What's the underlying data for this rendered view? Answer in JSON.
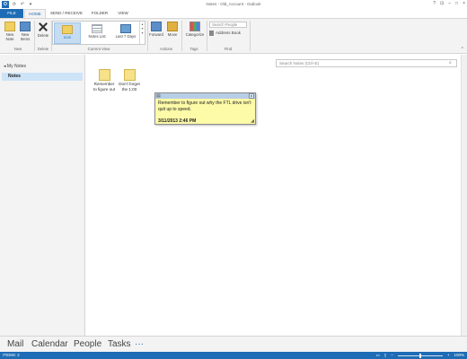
{
  "window": {
    "title": "Notes - Old_Account - Outlook",
    "app_icon": "O",
    "quick_access": [
      "save-icon",
      "undo-icon",
      "send-receive-icon"
    ],
    "controls": [
      "?",
      "□",
      "–",
      "□",
      "×"
    ]
  },
  "tabs": [
    {
      "label": "FILE"
    },
    {
      "label": "HOME"
    },
    {
      "label": "SEND / RECEIVE"
    },
    {
      "label": "FOLDER"
    },
    {
      "label": "VIEW"
    }
  ],
  "ribbon": {
    "new_note": "New Note",
    "new_items": "New Items",
    "delete": "Delete",
    "groups": {
      "new": "New",
      "delete": "Delete",
      "current_view": "Current View",
      "actions": "Actions",
      "tags": "Tags",
      "find": "Find"
    },
    "views": [
      {
        "label": "Icon",
        "selected": true
      },
      {
        "label": "Notes List",
        "selected": false
      },
      {
        "label": "Last 7 Days",
        "selected": false
      }
    ],
    "forward": "Forward",
    "move": "Move",
    "categorize": "Categorize",
    "search_people_placeholder": "Search People",
    "address_book": "Address Book"
  },
  "nav": {
    "my_notes": "My Notes",
    "notes": "Notes"
  },
  "main": {
    "search_placeholder": "Search Notes (Ctrl+E)",
    "notes": [
      {
        "label_line1": "Remember",
        "label_line2": "to figure out"
      },
      {
        "label_line1": "Don't forget",
        "label_line2": "the 1:00"
      }
    ],
    "sticky": {
      "text": "Remember to figure out why the FTL drive isn't quit up to speed.",
      "date": "3/11/2013 2:46 PM"
    }
  },
  "bottom_nav": {
    "mail": "Mail",
    "calendar": "Calendar",
    "people": "People",
    "tasks": "Tasks",
    "more": "···"
  },
  "status": {
    "items": "ITEMS: 2",
    "zoom": "100%"
  },
  "colors": {
    "accent": "#1e6cb5",
    "note_yellow": "#fdfaa8",
    "selected_nav": "#cde3f7"
  }
}
